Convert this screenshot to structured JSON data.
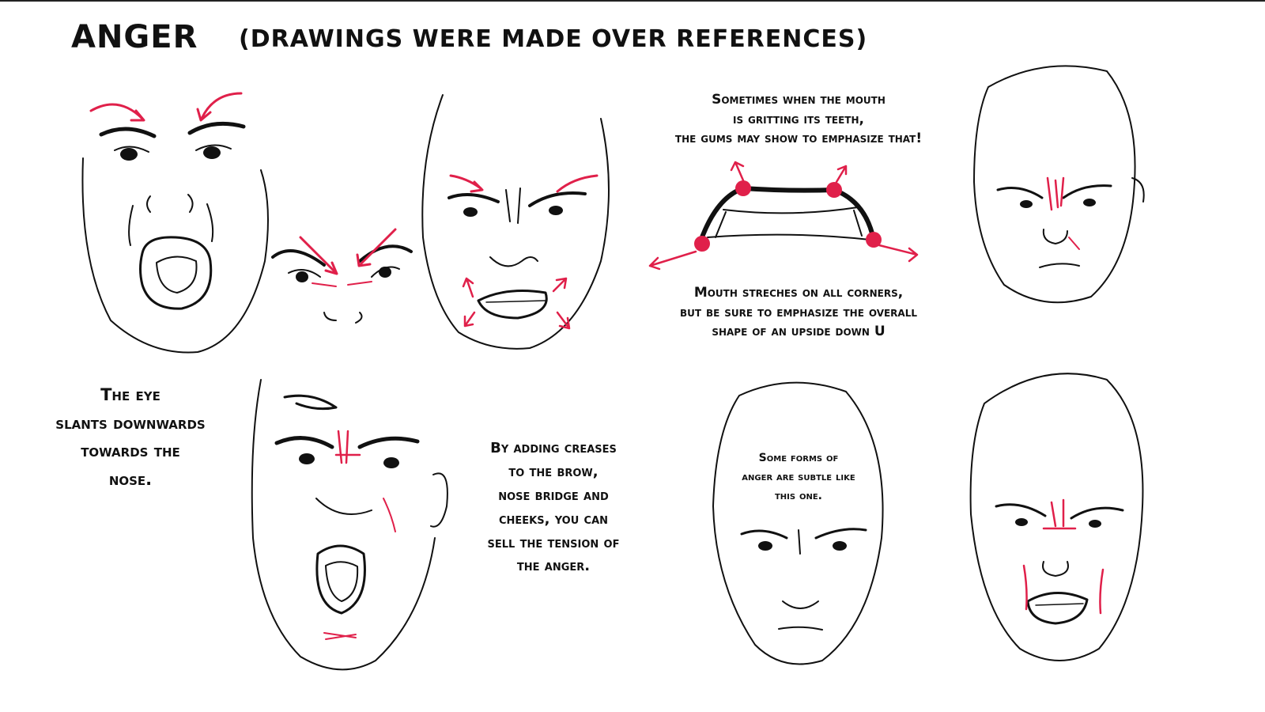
{
  "header": {
    "title": "ANGER",
    "subtitle": "(DRAWINGS WERE MADE OVER REFERENCES)"
  },
  "notes": {
    "gums": [
      "Sometimes when the mouth",
      "is gritting its teeth,",
      "the gums may show to emphasize that!"
    ],
    "mouth": [
      "Mouth streches on all corners,",
      "but be sure to emphasize the overall",
      "shape of an upside down U"
    ],
    "eye": [
      "The eye",
      "slants downwards",
      "towards the",
      "nose."
    ],
    "creases": [
      "By adding creases",
      "to the brow,",
      "nose bridge and",
      "cheeks, you can",
      "sell the tension of",
      "the anger."
    ],
    "subtle": [
      "Some forms of",
      "anger are subtle like",
      "this one."
    ]
  },
  "colors": {
    "ink": "#111111",
    "accent": "#e0204a",
    "background": "#ffffff"
  }
}
